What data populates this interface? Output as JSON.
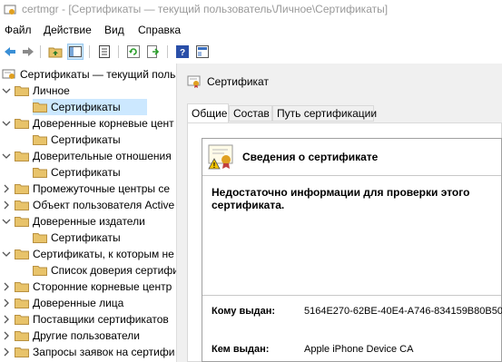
{
  "window": {
    "title": "certmgr - [Сертификаты — текущий пользователь\\Личное\\Сертификаты]"
  },
  "menu": [
    "Файл",
    "Действие",
    "Вид",
    "Справка"
  ],
  "toolbar": {
    "icons": [
      "back-icon",
      "forward-icon",
      "up-folder-icon",
      "show-hide-tree-icon",
      "properties-icon",
      "refresh-icon",
      "export-icon",
      "help-icon",
      "console-tree-icon"
    ]
  },
  "tree": {
    "items": [
      {
        "label": "Сертификаты — текущий польз",
        "level": 0,
        "expander": "",
        "icon": "cert-store"
      },
      {
        "label": "Личное",
        "level": 1,
        "expander": "open",
        "icon": "folder"
      },
      {
        "label": "Сертификаты",
        "level": 2,
        "expander": "",
        "icon": "folder",
        "selected": true
      },
      {
        "label": "Доверенные корневые цент",
        "level": 1,
        "expander": "open",
        "icon": "folder"
      },
      {
        "label": "Сертификаты",
        "level": 2,
        "expander": "",
        "icon": "folder"
      },
      {
        "label": "Доверительные отношения",
        "level": 1,
        "expander": "open",
        "icon": "folder"
      },
      {
        "label": "Сертификаты",
        "level": 2,
        "expander": "",
        "icon": "folder"
      },
      {
        "label": "Промежуточные центры се",
        "level": 1,
        "expander": "closed",
        "icon": "folder"
      },
      {
        "label": "Объект пользователя Active",
        "level": 1,
        "expander": "closed",
        "icon": "folder"
      },
      {
        "label": "Доверенные издатели",
        "level": 1,
        "expander": "open",
        "icon": "folder"
      },
      {
        "label": "Сертификаты",
        "level": 2,
        "expander": "",
        "icon": "folder"
      },
      {
        "label": "Сертификаты, к которым не",
        "level": 1,
        "expander": "open",
        "icon": "folder"
      },
      {
        "label": "Список доверия сертифи",
        "level": 2,
        "expander": "",
        "icon": "folder"
      },
      {
        "label": "Сторонние корневые центр",
        "level": 1,
        "expander": "closed",
        "icon": "folder"
      },
      {
        "label": "Доверенные лица",
        "level": 1,
        "expander": "closed",
        "icon": "folder"
      },
      {
        "label": "Поставщики сертификатов",
        "level": 1,
        "expander": "closed",
        "icon": "folder"
      },
      {
        "label": "Другие пользователи",
        "level": 1,
        "expander": "closed",
        "icon": "folder"
      },
      {
        "label": "Запросы заявок на сертифи",
        "level": 1,
        "expander": "closed",
        "icon": "folder"
      }
    ]
  },
  "dialog": {
    "title": "Сертификат",
    "tabs": [
      "Общие",
      "Состав",
      "Путь сертификации"
    ],
    "active_tab": 0,
    "info_header": "Сведения о сертификате",
    "warning": "Недостаточно информации для проверки этого сертификата.",
    "issued_to_label": "Кому выдан:",
    "issued_to_value": "5164E270-62BE-40E4-A746-834159B80B50",
    "issued_by_label": "Кем выдан:",
    "issued_by_value": "Apple iPhone Device CA"
  },
  "colors": {
    "selection": "#cce8ff",
    "folder": "#e8c36a",
    "accent": "#0078d7"
  }
}
